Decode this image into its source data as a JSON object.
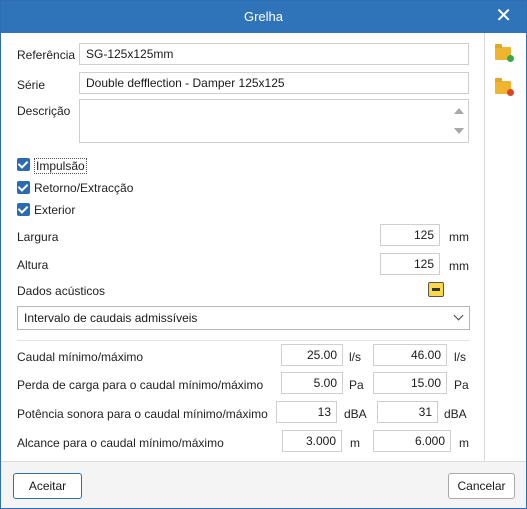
{
  "window": {
    "title": "Grelha"
  },
  "fields": {
    "referencia": {
      "label": "Referência",
      "value": "SG-125x125mm"
    },
    "serie": {
      "label": "Série",
      "value": "Double defflection - Damper 125x125"
    },
    "descricao": {
      "label": "Descrição",
      "value": ""
    }
  },
  "checkboxes": [
    {
      "label": "Impulsão",
      "checked": true
    },
    {
      "label": "Retorno/Extracção",
      "checked": true
    },
    {
      "label": "Exterior",
      "checked": true
    }
  ],
  "dimensions": {
    "largura": {
      "label": "Largura",
      "value": "125",
      "unit": "mm"
    },
    "altura": {
      "label": "Altura",
      "value": "125",
      "unit": "mm"
    }
  },
  "acoustic": {
    "label": "Dados acústicos",
    "icon": "acoustic-data-icon"
  },
  "dropdown": {
    "selected": "Intervalo de caudais admissíveis"
  },
  "ranges": [
    {
      "label": "Caudal mínimo/máximo",
      "min": "25.00",
      "max": "46.00",
      "unit_min": "l/s",
      "unit_max": "l/s"
    },
    {
      "label": "Perda de carga para o caudal mínimo/máximo",
      "min": "5.00",
      "max": "15.00",
      "unit_min": "Pa",
      "unit_max": "Pa"
    },
    {
      "label": "Potência sonora para o caudal mínimo/máximo",
      "min": "13",
      "max": "31",
      "unit_min": "dBA",
      "unit_max": "dBA"
    },
    {
      "label": "Alcance para o caudal mínimo/máximo",
      "min": "3.000",
      "max": "6.000",
      "unit_min": "m",
      "unit_max": "m"
    }
  ],
  "sidebar_icons": [
    "folder-add-icon",
    "folder-export-icon"
  ],
  "buttons": {
    "accept": "Aceitar",
    "cancel": "Cancelar"
  },
  "colors": {
    "titlebar": "#2f73b8",
    "accent": "#2b6cb0"
  }
}
